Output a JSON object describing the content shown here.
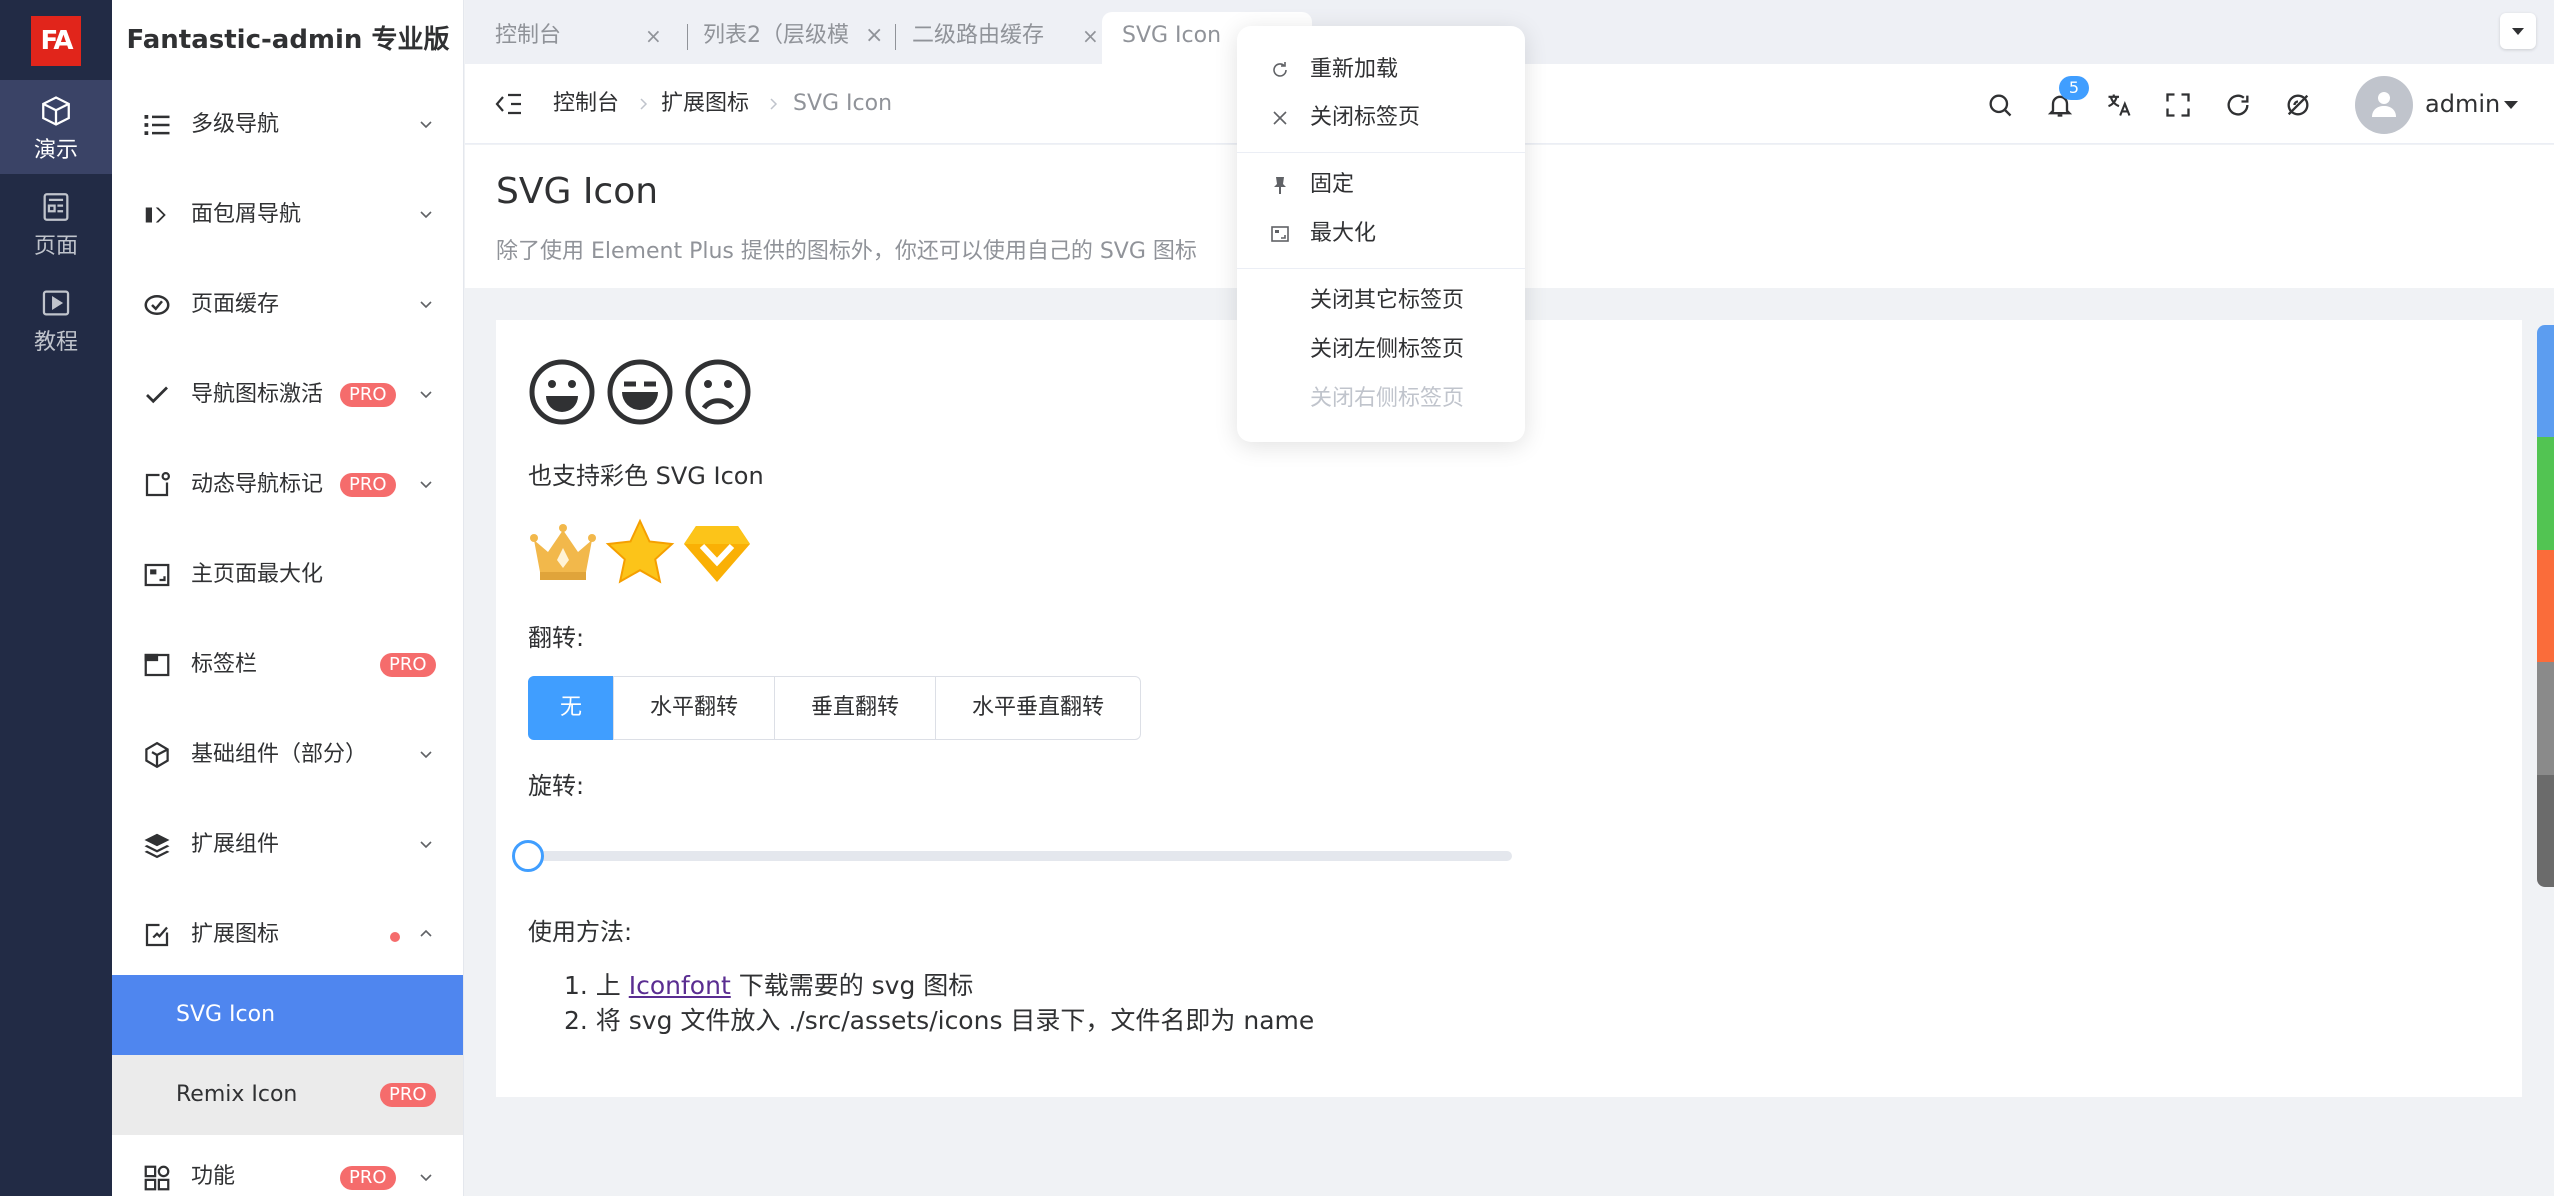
{
  "logo": {
    "text": "FA"
  },
  "main_nav": [
    {
      "label": "演示",
      "icon": "cube-icon",
      "active": true
    },
    {
      "label": "页面",
      "icon": "page-icon",
      "active": false
    },
    {
      "label": "教程",
      "icon": "video-icon",
      "active": false
    }
  ],
  "sidebar": {
    "title": "Fantastic-admin 专业版",
    "items": [
      {
        "label": "多级导航",
        "icon": "list-icon"
      },
      {
        "label": "面包屑导航",
        "icon": "breadcrumb-icon"
      },
      {
        "label": "页面缓存",
        "icon": "cache-icon"
      },
      {
        "label": "导航图标激活",
        "icon": "check-icon",
        "badge": "PRO"
      },
      {
        "label": "动态导航标记",
        "icon": "mark-icon",
        "badge": "PRO"
      },
      {
        "label": "主页面最大化",
        "icon": "maximize-icon"
      },
      {
        "label": "标签栏",
        "icon": "tabbar-icon",
        "badge": "PRO"
      },
      {
        "label": "基础组件（部分）",
        "icon": "component-icon"
      },
      {
        "label": "扩展组件",
        "icon": "layers-icon"
      },
      {
        "label": "扩展图标",
        "icon": "extend-icon"
      }
    ],
    "sub_items": [
      {
        "label": "SVG Icon",
        "active": true
      },
      {
        "label": "Remix Icon",
        "badge": "PRO"
      }
    ],
    "last_item": {
      "label": "功能",
      "badge": "PRO"
    }
  },
  "tabs": [
    {
      "label": "控制台"
    },
    {
      "label": "列表2（层级模"
    },
    {
      "label": "二级路由缓存"
    },
    {
      "label": "SVG Icon",
      "active": true
    }
  ],
  "breadcrumb": [
    "控制台",
    "扩展图标",
    "SVG Icon"
  ],
  "toolbar": {
    "notification_count": "5",
    "user": "admin"
  },
  "page": {
    "title": "SVG Icon",
    "description": "除了使用 Element Plus 提供的图标外，你还可以使用自己的 SVG 图标"
  },
  "content": {
    "color_support": "也支持彩色 SVG Icon",
    "flip_label": "翻转:",
    "flip_options": [
      "无",
      "水平翻转",
      "垂直翻转",
      "水平垂直翻转"
    ],
    "flip_selected": "无",
    "rotate_label": "旋转:",
    "rotate_value": 0,
    "usage_label": "使用方法:",
    "usage_steps": [
      {
        "prefix": "1. 上 ",
        "link": "Iconfont",
        "suffix": " 下载需要的 svg 图标"
      },
      {
        "text": "2. 将 svg 文件放入 ./src/assets/icons 目录下，文件名即为 name"
      }
    ]
  },
  "context_menu": [
    {
      "label": "重新加载",
      "icon": "reload-icon"
    },
    {
      "label": "关闭标签页",
      "icon": "close-icon"
    },
    {
      "label": "固定",
      "icon": "pin-icon"
    },
    {
      "label": "最大化",
      "icon": "maximize-icon"
    },
    {
      "label": "关闭其它标签页"
    },
    {
      "label": "关闭左侧标签页"
    },
    {
      "label": "关闭右侧标签页",
      "disabled": true
    }
  ],
  "colors": {
    "primary": "#409eff",
    "sidebar_dark": "#222b45",
    "menu_active": "#4f86ef",
    "pro_badge": "#f56c6c",
    "logo_red": "#e1251b",
    "theme_strip": [
      "#5c9df0",
      "#52c452",
      "#fa6c3a",
      "#8a8a8a",
      "#6b6b6b"
    ]
  }
}
